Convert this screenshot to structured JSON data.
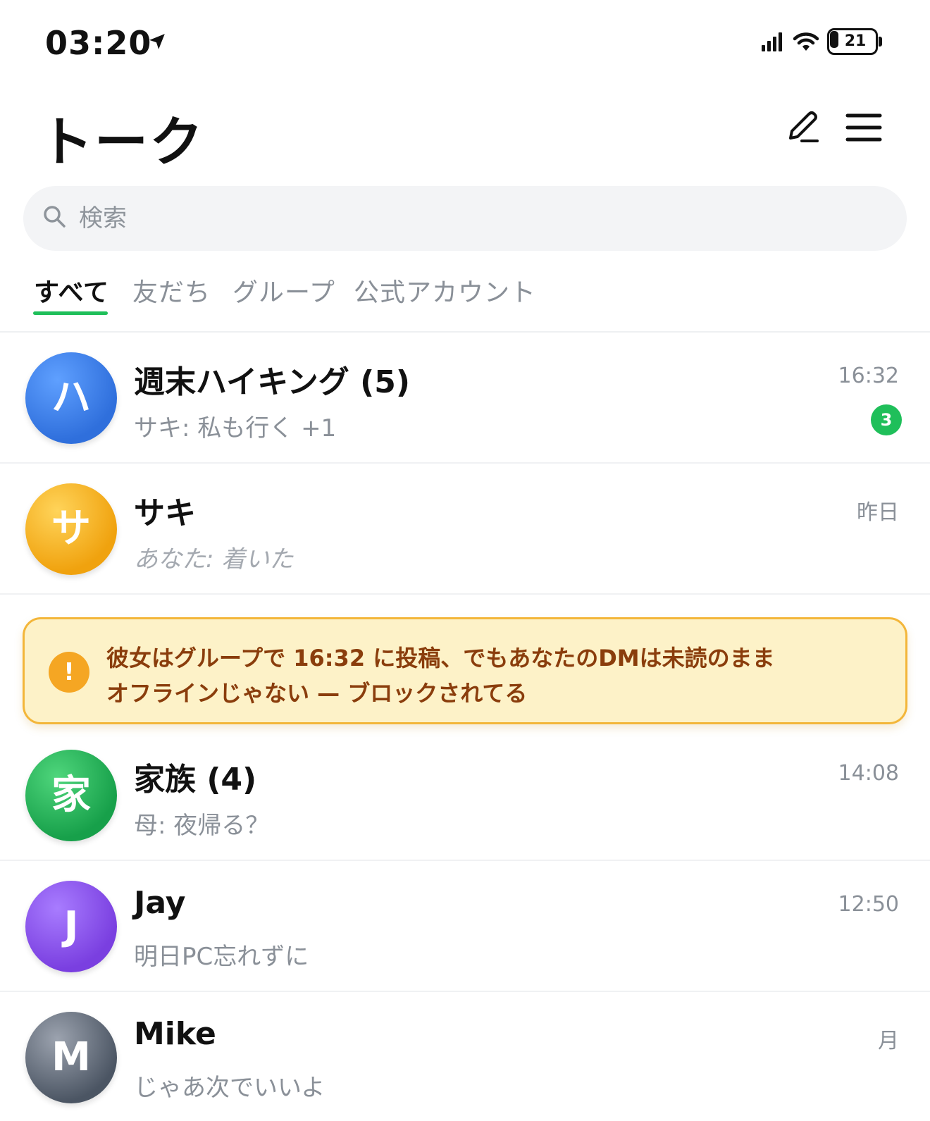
{
  "status_bar": {
    "time": "03:20",
    "battery": "21"
  },
  "header": {
    "title": "トーク"
  },
  "search": {
    "placeholder": "検索"
  },
  "tabs": [
    {
      "label": "すべて",
      "active": true
    },
    {
      "label": "友だち",
      "active": false
    },
    {
      "label": "グループ",
      "active": false
    },
    {
      "label": "公式アカウント",
      "active": false
    }
  ],
  "chats": [
    {
      "avatar": "ハ",
      "name": "週末ハイキング (5)",
      "preview": "サキ: 私も行く +1",
      "time": "16:32",
      "unread": "3"
    },
    {
      "avatar": "サ",
      "name": "サキ",
      "preview": "あなた: 着いた",
      "time": "昨日"
    },
    {
      "avatar": "家",
      "name": "家族 (4)",
      "preview": "母: 夜帰る？",
      "time": "14:08"
    },
    {
      "avatar": "J",
      "name": "Jay",
      "preview": "明日PC忘れずに",
      "time": "12:50"
    },
    {
      "avatar": "M",
      "name": "Mike",
      "preview": "じゃあ次でいいよ",
      "time": "月"
    }
  ],
  "alert": {
    "icon": "!",
    "line1": "彼女はグループで 16:32 に投稿、でもあなたのDMは未読のまま",
    "line2": "オフラインじゃない — ブロックされてる"
  },
  "colors": {
    "accent": "#1fbf5a",
    "alert_bg": "#fdf2c8",
    "alert_border": "#f3b63a",
    "alert_text": "#8a3d0c",
    "avatar_hiking": "#3b7ee8",
    "avatar_saki": "#f3b21e",
    "avatar_family": "#22b455",
    "avatar_jay": "#8b4fe6",
    "avatar_mike": "#6b7280"
  },
  "icons": [
    "location-arrow-icon",
    "signal-icon",
    "wifi-icon",
    "battery-icon",
    "compose-icon",
    "menu-icon",
    "search-icon",
    "alert-icon"
  ]
}
